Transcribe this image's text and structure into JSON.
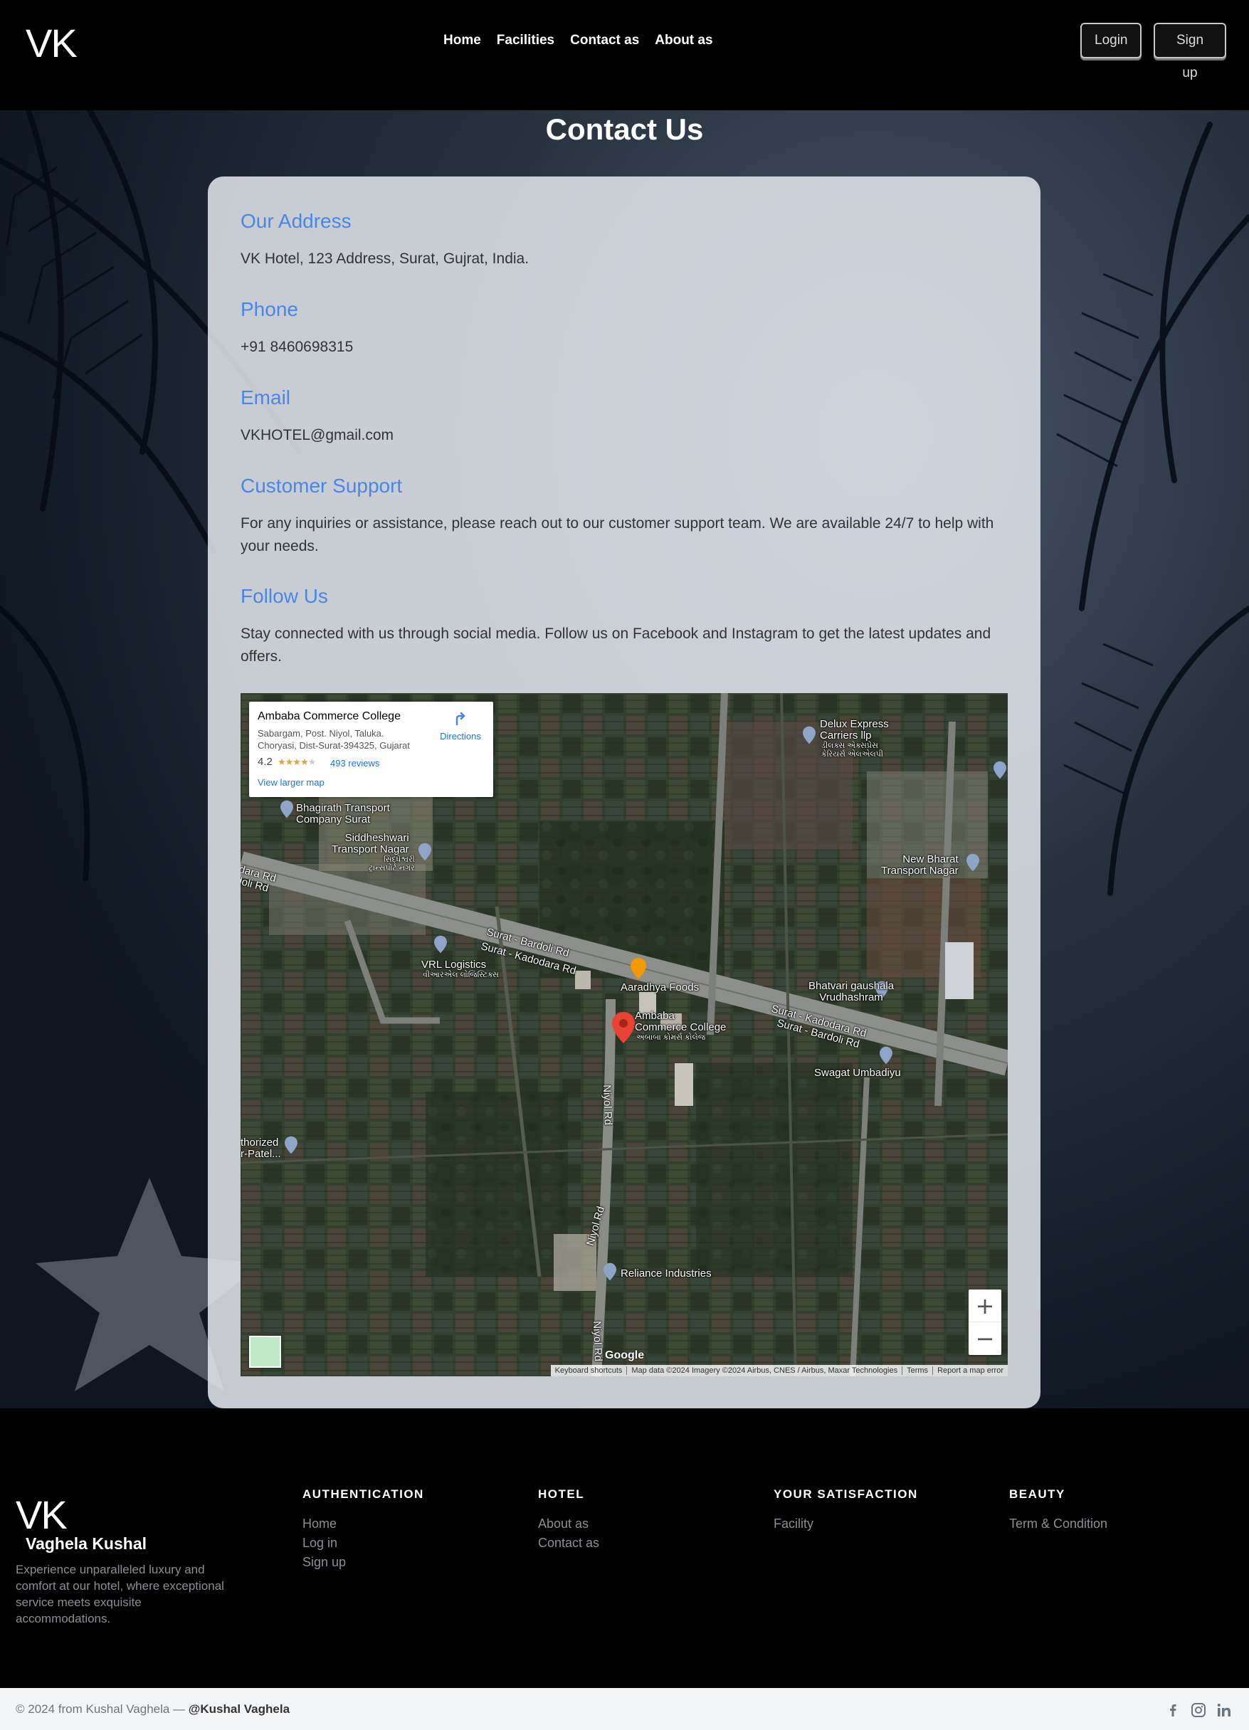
{
  "navbar": {
    "brand": "VK",
    "links": [
      "Home",
      "Facilities",
      "Contact as",
      "About as"
    ],
    "login_label": "Login",
    "signup_label": "Sign up"
  },
  "page": {
    "title": "Contact Us"
  },
  "contact": {
    "address_title": "Our Address",
    "address_text": "VK Hotel, 123 Address, Surat, Gujrat, India.",
    "phone_title": "Phone",
    "phone_text": "+91 8460698315",
    "email_title": "Email",
    "email_text": "VKHOTEL@gmail.com",
    "support_title": "Customer Support",
    "support_text": "For any inquiries or assistance, please reach out to our customer support team. We are available 24/7 to help with your needs.",
    "follow_title": "Follow Us",
    "follow_text": "Stay connected with us through social media. Follow us on Facebook and Instagram to get the latest updates and offers."
  },
  "map": {
    "place_name": "Ambaba Commerce College",
    "place_address": "Sabargam, Post. Niyol, Taluka. Choryasi, Dist-Surat-394325, Gujarat",
    "rating": "4.2",
    "rating_value": 4.2,
    "stars": "★★★★★",
    "reviews": "493 reviews",
    "larger_map": "View larger map",
    "directions": "Directions",
    "labels": {
      "delux": "Delux Express\nCarriers llp",
      "delux_local": "ડીલક્સ એક્સપ્રેસ\nકેરિયર્સ એલએલપી",
      "bhagirath": "Bhagirath Transport\nCompany Surat",
      "siddheshwari": "Siddheshwari\nTransport Nagar",
      "siddheshwari_local": "સિદ્ધેશ્વરી\nટ્રાન્સપોર્ટ નગર",
      "new_bharat": "New Bharat\nTransport Nagar",
      "road_left": "dara Rd\ndoli Rd",
      "surat_bardoli": "Surat - Bardoli Rd",
      "surat_kadodara": "Surat - Kadodara Rd",
      "vrl": "VRL Logistics",
      "vrl_local": "વીઆરએલ લોજિસ્ટિક્સ",
      "aaradhya": "Aaradhya Foods",
      "bhatvari": "Bhatvari gaushala\nVrudhashram",
      "ambaba": "Ambaba\nCommerce College",
      "ambaba_local": "અંબાબા કોમર્સ કોલેજ",
      "surat_kadodara_right": "Surat - Kadodara Rd",
      "surat_bardoli_right": "Surat - Bardoli Rd",
      "swagat": "Swagat Umbadiyu",
      "niyol_rd": "Niyol Rd",
      "authorized": "thorized\nr-Patel...",
      "niyol_rd_2": "Niyol Rd",
      "reliance": "Reliance Industries",
      "niyol_rd_3": "Niyol Rd"
    },
    "google": "Google",
    "attribution": [
      "Keyboard shortcuts",
      "Map data ©2024 Imagery ©2024 Airbus, CNES / Airbus, Maxar Technologies",
      "Terms",
      "Report a map error"
    ],
    "zoom_in": "+",
    "zoom_out": "−"
  },
  "footer": {
    "brand": "VK",
    "owner": "Vaghela Kushal",
    "description": "Experience unparalleled luxury and comfort at our hotel, where exceptional service meets exquisite accommodations.",
    "columns": [
      {
        "heading": "AUTHENTICATION",
        "links": [
          "Home",
          "Log in",
          "Sign up"
        ]
      },
      {
        "heading": "HOTEL",
        "links": [
          "About as",
          "Contact as"
        ]
      },
      {
        "heading": "YOUR SATISFACTION",
        "links": [
          "Facility"
        ]
      },
      {
        "heading": "BEAUTY",
        "links": [
          "Term & Condition"
        ]
      }
    ],
    "copyright": "© 2024 from Kushal Vaghela — ",
    "copyright_handle": "@Kushal Vaghela",
    "social_icons": [
      "facebook-icon",
      "instagram-icon",
      "linkedin-icon"
    ]
  },
  "colors": {
    "accent": "#4a86e8",
    "navbar_bg": "#000000",
    "card_bg": "#e4e8ee",
    "footer_link": "#8a8f96"
  }
}
